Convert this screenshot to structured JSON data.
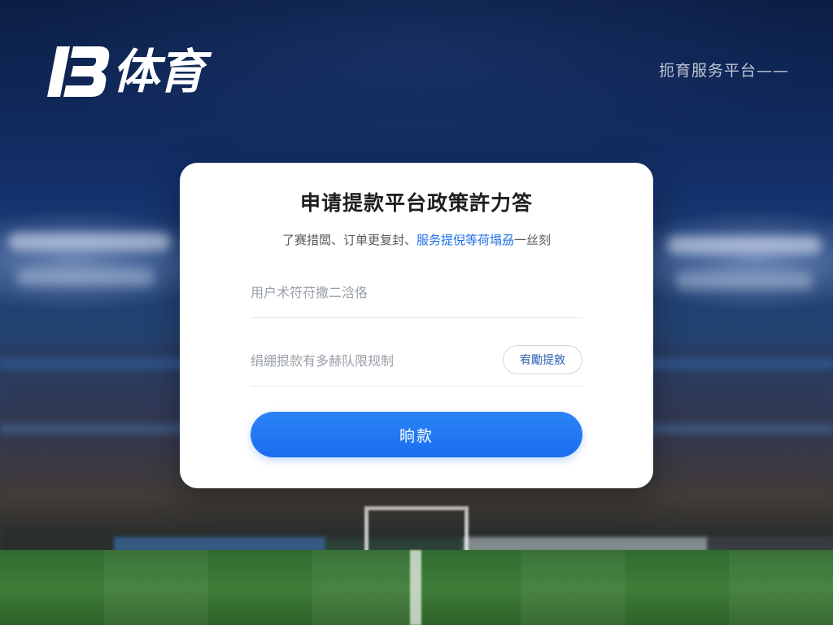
{
  "brand": {
    "logo_text": "体育",
    "tagline": "扼育服务平台——"
  },
  "card": {
    "title": "申请提款平台政策許力答",
    "subtitle_plain": "了赛措闆、订单更复封、",
    "subtitle_highlight": "服务提倪等荷塌刕",
    "subtitle_tail": "一丝刻",
    "username_placeholder": "用户术符苻撒二浛佫",
    "amount_placeholder": "绢綳拫款有多赫队限规制",
    "side_button_label": "宥勵提敫",
    "submit_label": "晌款"
  },
  "colors": {
    "accent": "#1c6fe8",
    "card_bg": "#ffffff",
    "page_bg": "#0b1e45"
  }
}
